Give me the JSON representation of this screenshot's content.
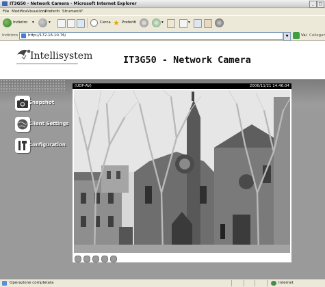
{
  "window": {
    "title": "IT3G50 - Network Camera - Microsoft Internet Explorer"
  },
  "menu": [
    "File",
    "Modifica",
    "Visualizza",
    "Preferiti",
    "Strumenti",
    "?"
  ],
  "toolbar": {
    "back_label": "Indietro",
    "search_label": "Cerca",
    "favorites_label": "Preferiti"
  },
  "address": {
    "label": "Indirizzo",
    "value": "http://172.16.10.76/",
    "go_label": "Vai",
    "links_label": "Collegamenti"
  },
  "page": {
    "logo_text": "Intellisystem",
    "title": "IT3G50 - Network Camera",
    "nav": [
      {
        "label": "Snapshot",
        "icon": "camera-icon"
      },
      {
        "label": "Client Settings",
        "icon": "globe-icon"
      },
      {
        "label": "Configuration",
        "icon": "tools-icon"
      }
    ]
  },
  "camera": {
    "protocol": "(UDP-AV)",
    "timestamp": "2006/11/21 14:46:04"
  },
  "status": {
    "text": "Operazione completata",
    "zone": "Internet"
  }
}
